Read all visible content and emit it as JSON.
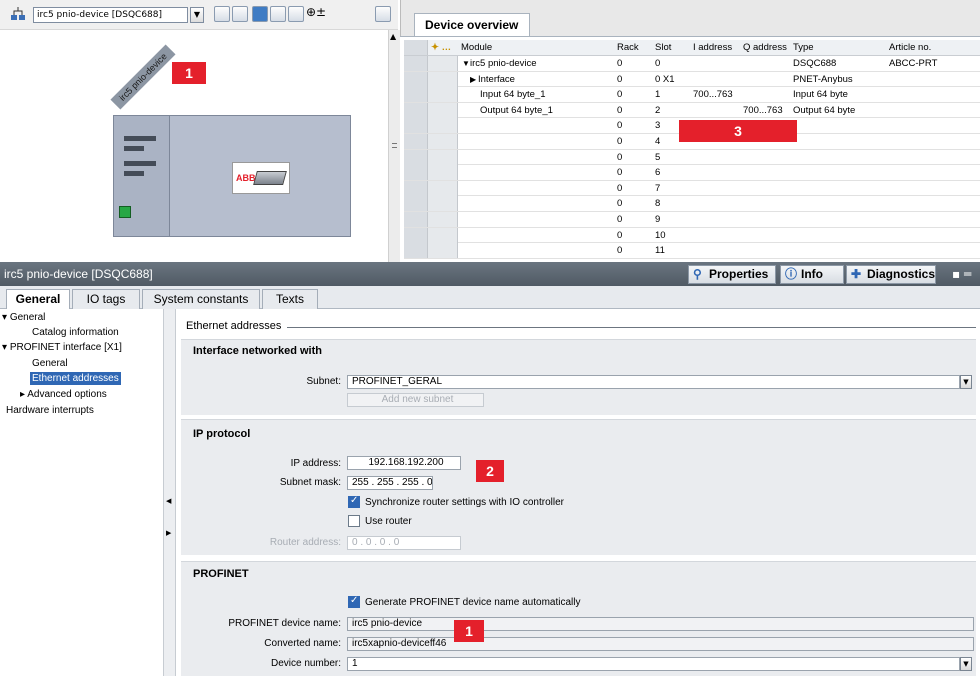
{
  "toolbar": {
    "device_select": "irc5 pnio-device [DSQC688]"
  },
  "canvas": {
    "device_label": "irc5 pnio-device",
    "module_logo": "ABB"
  },
  "overview": {
    "tab": "Device overview",
    "columns": [
      "",
      "Module",
      "Rack",
      "Slot",
      "I address",
      "Q address",
      "Type",
      "Article no."
    ],
    "rows": [
      {
        "module": "irc5 pnio-device",
        "rack": "0",
        "slot": "0",
        "i": "",
        "q": "",
        "type": "DSQC688",
        "article": "ABCC-PRT"
      },
      {
        "module": "Interface",
        "rack": "0",
        "slot": "0 X1",
        "i": "",
        "q": "",
        "type": "PNET-Anybus",
        "article": ""
      },
      {
        "module": "Input 64 byte_1",
        "rack": "0",
        "slot": "1",
        "i": "700...763",
        "q": "",
        "type": "Input 64 byte",
        "article": ""
      },
      {
        "module": "Output 64 byte_1",
        "rack": "0",
        "slot": "2",
        "i": "",
        "q": "700...763",
        "type": "Output 64 byte",
        "article": ""
      },
      {
        "module": "",
        "rack": "0",
        "slot": "3",
        "i": "",
        "q": "",
        "type": "",
        "article": ""
      },
      {
        "module": "",
        "rack": "0",
        "slot": "4",
        "i": "",
        "q": "",
        "type": "",
        "article": ""
      },
      {
        "module": "",
        "rack": "0",
        "slot": "5",
        "i": "",
        "q": "",
        "type": "",
        "article": ""
      },
      {
        "module": "",
        "rack": "0",
        "slot": "6",
        "i": "",
        "q": "",
        "type": "",
        "article": ""
      },
      {
        "module": "",
        "rack": "0",
        "slot": "7",
        "i": "",
        "q": "",
        "type": "",
        "article": ""
      },
      {
        "module": "",
        "rack": "0",
        "slot": "8",
        "i": "",
        "q": "",
        "type": "",
        "article": ""
      },
      {
        "module": "",
        "rack": "0",
        "slot": "9",
        "i": "",
        "q": "",
        "type": "",
        "article": ""
      },
      {
        "module": "",
        "rack": "0",
        "slot": "10",
        "i": "",
        "q": "",
        "type": "",
        "article": ""
      },
      {
        "module": "",
        "rack": "0",
        "slot": "11",
        "i": "",
        "q": "",
        "type": "",
        "article": ""
      }
    ]
  },
  "inspector": {
    "title": "irc5 pnio-device [DSQC688]",
    "right_tabs": [
      "Properties",
      "Info",
      "Diagnostics"
    ],
    "tabs": [
      "General",
      "IO tags",
      "System constants",
      "Texts"
    ],
    "nav": [
      "General",
      "Catalog information",
      "PROFINET interface [X1]",
      "General",
      "Ethernet addresses",
      "Advanced options",
      "Hardware interrupts"
    ]
  },
  "content": {
    "header": "Ethernet addresses",
    "s1": {
      "title": "Interface networked with",
      "subnet_label": "Subnet:",
      "subnet": "PROFINET_GERAL",
      "add_subnet": "Add new subnet"
    },
    "s2": {
      "title": "IP protocol",
      "ip_label": "IP address:",
      "ip": "192.168.192.200",
      "mask_label": "Subnet mask:",
      "mask": "255 . 255 . 255 . 0",
      "sync": "Synchronize router settings with IO controller",
      "use_router": "Use router",
      "router_label": "Router address:",
      "router": "0 . 0 . 0 . 0"
    },
    "s3": {
      "title": "PROFINET",
      "gen": "Generate PROFINET device name automatically",
      "name_label": "PROFINET device name:",
      "name": "irc5 pnio-device",
      "conv_label": "Converted name:",
      "conv": "irc5xapnio-deviceff46",
      "num_label": "Device number:",
      "num": "1"
    }
  },
  "badges": [
    "1",
    "3",
    "2",
    "1"
  ]
}
